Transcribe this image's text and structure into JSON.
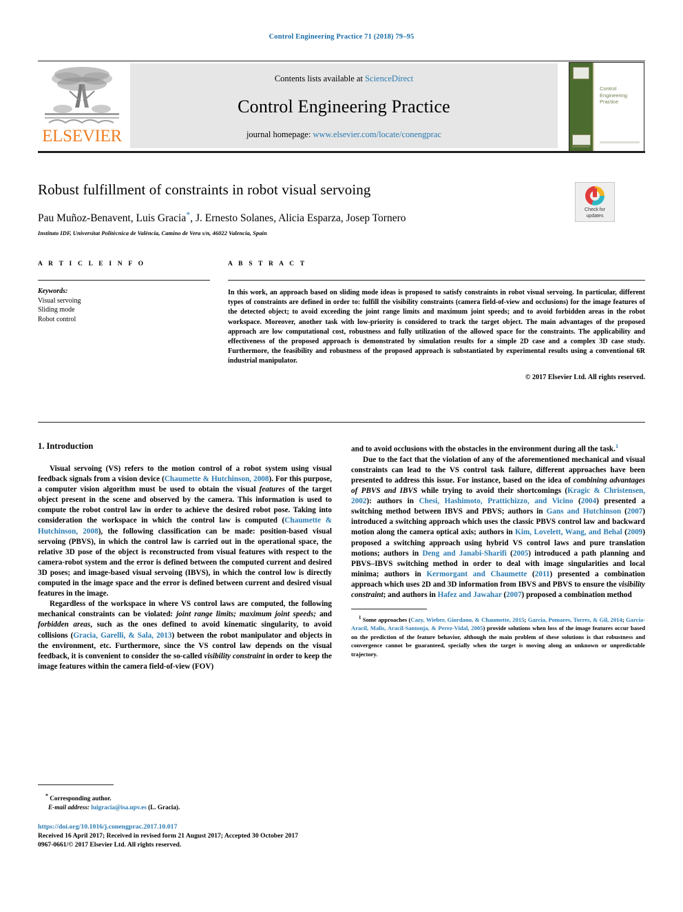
{
  "running_head": "Control Engineering Practice 71 (2018) 79–95",
  "masthead": {
    "contents_prefix": "Contents lists available at ",
    "sciencedirect": "ScienceDirect",
    "journal_title": "Control Engineering Practice",
    "homepage_prefix": "journal homepage: ",
    "homepage_url": "www.elsevier.com/locate/conengprac",
    "publisher_name": "ELSEVIER",
    "cover_title": "Control Engineering Practice",
    "band_color": "#e6e6e6",
    "link_color": "#2a7ab0",
    "elsevier_orange": "#ef7d22"
  },
  "title_block": {
    "title": "Robust fulfillment of constraints in robot visual servoing",
    "authors": "Pau Muñoz-Benavent, Luis Gracia",
    "authors_rest": ", J. Ernesto Solanes, Alicia Esparza, Josep Tornero",
    "corresponding_marker": "*",
    "affiliation": "Instituto IDF, Universitat Politècnica de València, Camino de Vera s/n, 46022 Valencia, Spain",
    "crossmark_label": "Check for updates"
  },
  "article_info": {
    "heading": "A R T I C L E    I N F O",
    "keywords_heading": "Keywords:",
    "keywords": [
      "Visual servoing",
      "Sliding mode",
      "Robot control"
    ]
  },
  "abstract": {
    "heading": "A B S T R A C T",
    "text": "In this work, an approach based on sliding mode ideas is proposed to satisfy constraints in robot visual servoing. In particular, different types of constraints are defined in order to: fulfill the visibility constraints (camera field-of-view and occlusions) for the image features of the detected object; to avoid exceeding the joint range limits and maximum joint speeds; and to avoid forbidden areas in the robot workspace. Moreover, another task with low-priority is considered to track the target object. The main advantages of the proposed approach are low computational cost, robustness and fully utilization of the allowed space for the constraints. The applicability and effectiveness of the proposed approach is demonstrated by simulation results for a simple 2D case and a complex 3D case study. Furthermore, the feasibility and robustness of the proposed approach is substantiated by experimental results using a conventional 6R industrial manipulator.",
    "copyright": "© 2017 Elsevier Ltd. All rights reserved."
  },
  "body": {
    "section_heading": "1.  Introduction",
    "left": {
      "p1_a": "Visual servoing (VS) refers to the motion control of a robot system using visual feedback signals from a vision device (",
      "p1_ref1": "Chaumette & Hutchinson, 2008",
      "p1_b": "). For this purpose, a computer vision algorithm must be used to obtain the visual ",
      "p1_it1": "features",
      "p1_c": " of the target object present in the scene and observed by the camera. This information is used to compute the robot control law in order to achieve the desired robot pose. Taking into consideration the workspace in which the control law is computed (",
      "p1_ref2": "Chaumette & Hutchinson, 2008",
      "p1_d": "), the following classification can be made: position-based visual servoing (PBVS), in which the control law is carried out in the operational space, the relative 3D pose of the object is reconstructed from visual features with respect to the camera-robot system and the error is defined between the computed current and desired 3D poses; and image-based visual servoing (IBVS), in which the control low is directly computed in the image space and the error is defined between current and desired visual features in the image.",
      "p2_a": "Regardless of the workspace in where VS control laws are computed, the following mechanical constraints can be violated: ",
      "p2_it1": "joint range limits; maximum joint speeds;",
      "p2_b": " and ",
      "p2_it2": "forbidden areas",
      "p2_c": ", such as the ones defined to avoid kinematic singularity, to avoid collisions (",
      "p2_ref1": "Gracia, Garelli, & Sala, 2013",
      "p2_d": ") between the robot manipulator and objects in the environment, etc. Furthermore, since the VS control law depends on the visual feedback, it is convenient to consider the so-called ",
      "p2_it3": "visibility constraint",
      "p2_e": " in order to keep the image features within the camera field-of-view (FOV)"
    },
    "right": {
      "p1_a": "and to avoid occlusions with the obstacles in the environment during all the task.",
      "p1_fn": "1",
      "p2_a": "Due to the fact that the violation of any of the aforementioned mechanical and visual constraints can lead to the VS control task failure, different approaches have been presented to address this issue. For instance, based on the idea of ",
      "p2_it1": "combining advantages of PBVS and IBVS",
      "p2_b": " while trying to avoid their shortcomings (",
      "p2_ref1": "Kragic & Christensen, 2002",
      "p2_c": "): authors in ",
      "p2_ref2": "Chesi, Hashimoto, Prattichizzo, and Vicino",
      "p2_d": " (",
      "p2_ref2y": "2004",
      "p2_e": ") presented a switching method between IBVS and PBVS; authors in ",
      "p2_ref3": "Gans and Hutchinson",
      "p2_f": " (",
      "p2_ref3y": "2007",
      "p2_g": ") introduced a switching approach which uses the classic PBVS control law and backward motion along the camera optical axis; authors in ",
      "p2_ref4": "Kim, Lovelett, Wang, and Behal",
      "p2_h": " (",
      "p2_ref4y": "2009",
      "p2_i": ") proposed a switching approach using hybrid VS control laws and pure translation motions; authors in ",
      "p2_ref5": "Deng and Janabi-Sharifi",
      "p2_j": " (",
      "p2_ref5y": "2005",
      "p2_k": ") introduced a path planning and PBVS–IBVS switching method in order to deal with image singularities and local minima; authors in ",
      "p2_ref6": "Kermorgant and Chaumette",
      "p2_l": " (",
      "p2_ref6y": "2011",
      "p2_m": ") presented a combination approach which uses 2D and 3D information from IBVS and PBVS to ensure the ",
      "p2_it2": "visibility constraint",
      "p2_n": "; and authors in ",
      "p2_ref7": "Hafez and Jawahar",
      "p2_o": " (",
      "p2_ref7y": "2007",
      "p2_p": ") proposed a combination method"
    },
    "footnote": {
      "marker": "1",
      "a": " Some approaches (",
      "ref1": "Cazy, Wieber, Giordano, & Chaumette, 2015",
      "b": "; ",
      "ref2": "Garcia, Pomares, Torres, & Gil, 2014",
      "c": "; ",
      "ref3": "Garcia-Aracil, Malis, Aracil-Santonja, & Perez-Vidal, 2005",
      "d": ") provide solutions when loss of the image features occur based on the prediction of the feature behavior, although the main problem of these solutions is that robustness and convergence cannot be guaranteed, specially when the target is moving along an unknown or unpredictable trajectory."
    }
  },
  "page_footer": {
    "corresponding_star": "*",
    "corresponding_text": "Corresponding author.",
    "email_label": "E-mail address:",
    "email": "luigracia@isa.upv.es",
    "email_suffix": "(L. Gracia).",
    "doi": "https://doi.org/10.1016/j.conengprac.2017.10.017",
    "dates": "Received 16 April 2017; Received in revised form 21 August 2017; Accepted 30 October 2017",
    "issn": "0967-0661/© 2017 Elsevier Ltd. All rights reserved."
  }
}
